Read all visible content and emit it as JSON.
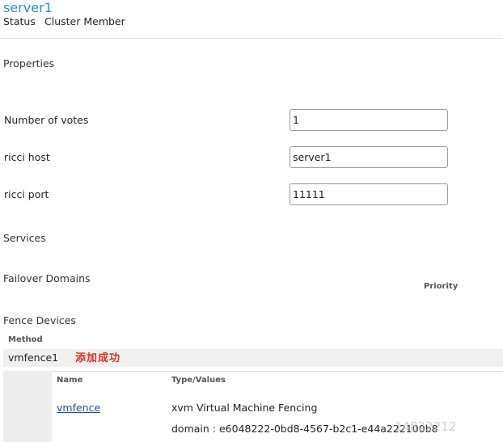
{
  "node": {
    "name": "server1",
    "status_label": "Status",
    "status_value": "Cluster Member"
  },
  "properties": {
    "heading": "Properties",
    "fields": [
      {
        "label": "Number of votes",
        "value": "1"
      },
      {
        "label": "ricci host",
        "value": "server1"
      },
      {
        "label": "ricci port",
        "value": "11111"
      }
    ]
  },
  "services": {
    "heading": "Services"
  },
  "failover_domains": {
    "heading": "Failover Domains",
    "priority_header": "Priority"
  },
  "fence_devices": {
    "heading": "Fence Devices",
    "method_header": "Method",
    "method_name": "vmfence1",
    "annotation": "添加成功",
    "table": {
      "name_header": "Name",
      "type_header": "Type/Values",
      "device_name": "vmfence",
      "device_type": "xvm Virtual Machine Fencing",
      "device_domain": "domain : e6048222-0bd8-4567-b2c1-e44a222100b8"
    }
  },
  "watermark": "14822212",
  "colors": {
    "title": "#2a8fbd",
    "link": "#1a4fa0",
    "annotation": "#e0301e",
    "row_background": "#f0f0f0"
  }
}
